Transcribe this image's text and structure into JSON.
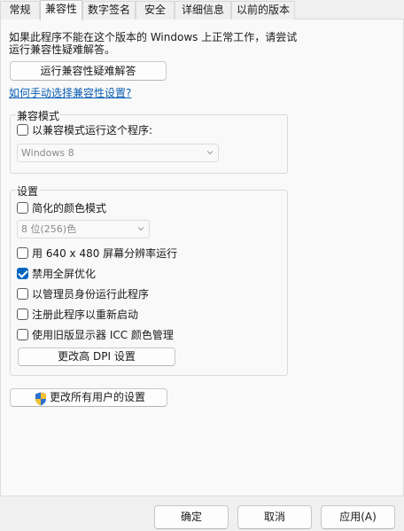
{
  "tabs": [
    {
      "label": "常规"
    },
    {
      "label": "兼容性"
    },
    {
      "label": "数字签名"
    },
    {
      "label": "安全"
    },
    {
      "label": "详细信息"
    },
    {
      "label": "以前的版本"
    }
  ],
  "description": "如果此程序不能在这个版本的 Windows 上正常工作，请尝试运行兼容性疑难解答。",
  "troubleshooter_button": "运行兼容性疑难解答",
  "manual_link": "如何手动选择兼容性设置?",
  "compat_mode": {
    "group_label": "兼容模式",
    "checkbox_label": "以兼容模式运行这个程序:",
    "checked": false,
    "os_select_value": "Windows 8"
  },
  "settings": {
    "group_label": "设置",
    "reduced_color": {
      "label": "简化的颜色模式",
      "checked": false
    },
    "color_select_value": "8 位(256)色",
    "res_640": {
      "label": "用 640 x 480 屏幕分辨率运行",
      "checked": false
    },
    "disable_fullscreen_opt": {
      "label": "禁用全屏优化",
      "checked": true
    },
    "run_as_admin": {
      "label": "以管理员身份运行此程序",
      "checked": false
    },
    "register_restart": {
      "label": "注册此程序以重新启动",
      "checked": false
    },
    "legacy_icc": {
      "label": "使用旧版显示器 ICC 颜色管理",
      "checked": false
    },
    "dpi_button": "更改高 DPI 设置"
  },
  "all_users_button": "更改所有用户的设置",
  "footer": {
    "ok": "确定",
    "cancel": "取消",
    "apply": "应用(A)"
  },
  "colors": {
    "accent": "#0067c0",
    "link": "#0a5fb4"
  },
  "icons": [
    "uac-shield-icon",
    "chevron-down-icon",
    "checkmark-icon"
  ]
}
